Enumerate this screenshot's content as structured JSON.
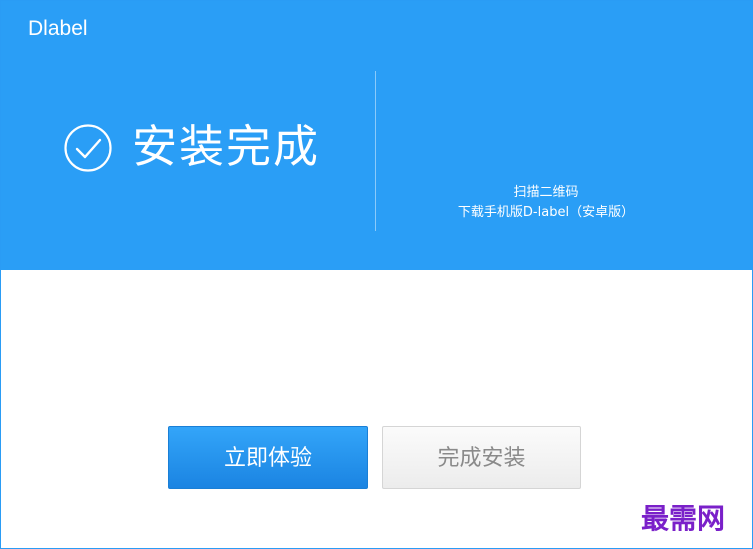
{
  "window": {
    "app_title": "Dlabel"
  },
  "status": {
    "icon": "check-circle-icon",
    "title": "安装完成"
  },
  "qr_promo": {
    "line1": "扫描二维码",
    "line2": "下载手机版D-label（安卓版）"
  },
  "actions": {
    "try_now_label": "立即体验",
    "finish_install_label": "完成安装"
  },
  "watermark": {
    "text": "最需网"
  },
  "colors": {
    "header_bg": "#2a9ef6",
    "primary_button": "#2a96ee",
    "watermark": "#7a20c9"
  }
}
